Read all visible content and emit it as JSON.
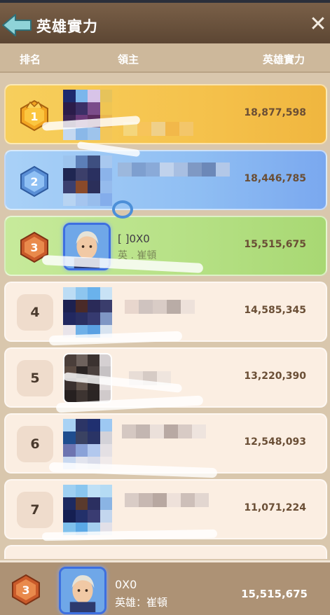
{
  "header": {
    "title": "英雄實力"
  },
  "columns": {
    "rank": "排名",
    "lord": "領主",
    "power": "英雄實力"
  },
  "rows": [
    {
      "rank": "1",
      "power": "18,877,598"
    },
    {
      "rank": "2",
      "power": "18,446,785"
    },
    {
      "rank": "3",
      "name": "[   ]0X0",
      "sub": "英 . 崔頓",
      "power": "15,515,675"
    },
    {
      "rank": "4",
      "power": "14,585,345"
    },
    {
      "rank": "5",
      "power": "13,220,390"
    },
    {
      "rank": "6",
      "power": "12,548,093"
    },
    {
      "rank": "7",
      "power": "11,071,224"
    }
  ],
  "me": {
    "rank": "3",
    "name": "0X0",
    "sub": "英雄：崔頓",
    "power": "15,515,675"
  },
  "colors": {
    "gold": "#f5c24c",
    "blue": "#8fbef3",
    "green": "#b5e084",
    "plain": "#fbeee2"
  },
  "icons": {
    "back": "back-arrow-icon",
    "close": "close-icon",
    "medal": "rank-medal-icon"
  }
}
